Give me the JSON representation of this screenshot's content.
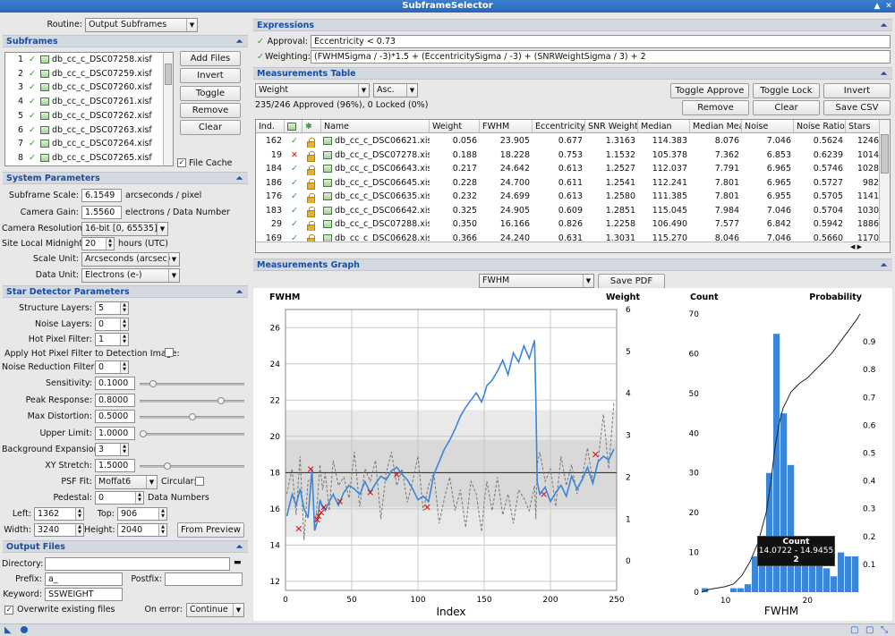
{
  "window": {
    "title": "SubframeSelector"
  },
  "routine": {
    "label": "Routine:",
    "value": "Output Subframes"
  },
  "subframes": {
    "header": "Subframes",
    "rows": [
      {
        "n": "1",
        "file": "db_cc_c_DSC07258.xisf"
      },
      {
        "n": "2",
        "file": "db_cc_c_DSC07259.xisf"
      },
      {
        "n": "3",
        "file": "db_cc_c_DSC07260.xisf"
      },
      {
        "n": "4",
        "file": "db_cc_c_DSC07261.xisf"
      },
      {
        "n": "5",
        "file": "db_cc_c_DSC07262.xisf"
      },
      {
        "n": "6",
        "file": "db_cc_c_DSC07263.xisf"
      },
      {
        "n": "7",
        "file": "db_cc_c_DSC07264.xisf"
      },
      {
        "n": "8",
        "file": "db_cc_c_DSC07265.xisf"
      }
    ],
    "buttons": [
      "Add Files",
      "Invert",
      "Toggle",
      "Remove",
      "Clear"
    ],
    "file_cache": "File Cache"
  },
  "system": {
    "header": "System Parameters",
    "subframe_scale": {
      "label": "Subframe Scale:",
      "value": "6.1549",
      "unit": "arcseconds / pixel"
    },
    "camera_gain": {
      "label": "Camera Gain:",
      "value": "1.5560",
      "unit": "electrons / Data Number"
    },
    "camera_resolution": {
      "label": "Camera Resolution:",
      "value": "16-bit [0, 65535]"
    },
    "site_midnight": {
      "label": "Site Local Midnight:",
      "value": "20",
      "unit": "hours (UTC)"
    },
    "scale_unit": {
      "label": "Scale Unit:",
      "value": "Arcseconds (arcsec)"
    },
    "data_unit": {
      "label": "Data Unit:",
      "value": "Electrons (e-)"
    }
  },
  "star": {
    "header": "Star Detector Parameters",
    "structure_layers": {
      "label": "Structure Layers:",
      "value": "5"
    },
    "noise_layers": {
      "label": "Noise Layers:",
      "value": "0"
    },
    "hot_pixel": {
      "label": "Hot Pixel Filter:",
      "value": "1"
    },
    "apply_hot": {
      "label": "Apply Hot Pixel Filter to Detection Image:"
    },
    "noise_reduction": {
      "label": "Noise Reduction Filter:",
      "value": "0"
    },
    "sensitivity": {
      "label": "Sensitivity:",
      "value": "0.1000",
      "level": 0.1
    },
    "peak_response": {
      "label": "Peak Response:",
      "value": "0.8000",
      "level": 0.8
    },
    "max_distortion": {
      "label": "Max Distortion:",
      "value": "0.5000",
      "level": 0.5
    },
    "upper_limit": {
      "label": "Upper Limit:",
      "value": "1.0000",
      "level": 0.0
    },
    "background_expansion": {
      "label": "Background Expansion:",
      "value": "3"
    },
    "xy_stretch": {
      "label": "XY Stretch:",
      "value": "1.5000",
      "level": 0.25
    },
    "psf_fit": {
      "label": "PSF Fit:",
      "value": "Moffat6"
    },
    "circular": {
      "label": "Circular:"
    },
    "pedestal": {
      "label": "Pedestal:",
      "value": "0",
      "unit": "Data Numbers"
    },
    "left": {
      "label": "Left:",
      "value": "1362"
    },
    "top": {
      "label": "Top:",
      "value": "906"
    },
    "width": {
      "label": "Width:",
      "value": "3240"
    },
    "height": {
      "label": "Height:",
      "value": "2040"
    },
    "from_preview": "From Preview"
  },
  "output": {
    "header": "Output Files",
    "directory": {
      "label": "Directory:",
      "value": ""
    },
    "prefix": {
      "label": "Prefix:",
      "value": "a_"
    },
    "postfix": {
      "label": "Postfix:",
      "value": ""
    },
    "keyword": {
      "label": "Keyword:",
      "value": "SSWEIGHT"
    },
    "overwrite": "Overwrite existing files",
    "on_error": {
      "label": "On error:",
      "value": "Continue"
    }
  },
  "expressions": {
    "header": "Expressions",
    "approval": {
      "label": "Approval:",
      "value": "Eccentricity < 0.73"
    },
    "weighting": {
      "label": "Weighting:",
      "value": "(FWHMSigma / -3)*1.5 + (EccentricitySigma / -3) + (SNRWeightSigma / 3) + 2"
    }
  },
  "measurements": {
    "header": "Measurements Table",
    "sort_key": "Weight",
    "sort_order": "Asc.",
    "summary": "235/246 Approved (96%), 0 Locked (0%)",
    "buttons": {
      "toggle_approve": "Toggle Approve",
      "toggle_lock": "Toggle Lock",
      "invert": "Invert",
      "remove": "Remove",
      "clear": "Clear",
      "save_csv": "Save CSV"
    },
    "columns": [
      "Ind.",
      "",
      "",
      "Name",
      "Weight",
      "FWHM",
      "Eccentricity",
      "SNR Weight",
      "Median",
      "Median Mea",
      "Noise",
      "Noise Ratio",
      "Stars"
    ],
    "rows": [
      {
        "ind": "162",
        "ok": true,
        "name": "db_cc_c_DSC06621.xisf",
        "weight": "0.056",
        "fwhm": "23.905",
        "ecc": "0.677",
        "snr": "1.3163",
        "median": "114.383",
        "mm": "8.076",
        "noise": "7.046",
        "nr": "0.5624",
        "stars": "1246"
      },
      {
        "ind": "19",
        "ok": false,
        "name": "db_cc_c_DSC07278.xisf",
        "weight": "0.188",
        "fwhm": "18.228",
        "ecc": "0.753",
        "snr": "1.1532",
        "median": "105.378",
        "mm": "7.362",
        "noise": "6.853",
        "nr": "0.6239",
        "stars": "1014"
      },
      {
        "ind": "184",
        "ok": true,
        "name": "db_cc_c_DSC06643.xisf",
        "weight": "0.217",
        "fwhm": "24.642",
        "ecc": "0.613",
        "snr": "1.2527",
        "median": "112.037",
        "mm": "7.791",
        "noise": "6.965",
        "nr": "0.5746",
        "stars": "1028"
      },
      {
        "ind": "186",
        "ok": true,
        "name": "db_cc_c_DSC06645.xisf",
        "weight": "0.228",
        "fwhm": "24.700",
        "ecc": "0.611",
        "snr": "1.2541",
        "median": "112.241",
        "mm": "7.801",
        "noise": "6.965",
        "nr": "0.5727",
        "stars": "982"
      },
      {
        "ind": "176",
        "ok": true,
        "name": "db_cc_c_DSC06635.xisf",
        "weight": "0.232",
        "fwhm": "24.699",
        "ecc": "0.613",
        "snr": "1.2580",
        "median": "111.385",
        "mm": "7.801",
        "noise": "6.955",
        "nr": "0.5705",
        "stars": "1141"
      },
      {
        "ind": "183",
        "ok": true,
        "name": "db_cc_c_DSC06642.xisf",
        "weight": "0.325",
        "fwhm": "24.905",
        "ecc": "0.609",
        "snr": "1.2851",
        "median": "115.045",
        "mm": "7.984",
        "noise": "7.046",
        "nr": "0.5704",
        "stars": "1030"
      },
      {
        "ind": "29",
        "ok": true,
        "name": "db_cc_c_DSC07288.xisf",
        "weight": "0.350",
        "fwhm": "16.166",
        "ecc": "0.826",
        "snr": "1.2258",
        "median": "106.490",
        "mm": "7.577",
        "noise": "6.842",
        "nr": "0.5942",
        "stars": "1886"
      },
      {
        "ind": "169",
        "ok": true,
        "name": "db_cc_c_DSC06628.xisf",
        "weight": "0.366",
        "fwhm": "24.240",
        "ecc": "0.631",
        "snr": "1.3031",
        "median": "115.270",
        "mm": "8.046",
        "noise": "7.046",
        "nr": "0.5660",
        "stars": "1170"
      }
    ]
  },
  "graph": {
    "header": "Measurements Graph",
    "y_property": "FWHM",
    "save_pdf": "Save PDF",
    "tooltip": {
      "title": "Count",
      "range": "14.0722 - 14.9455",
      "count": "2"
    }
  },
  "chart_data": [
    {
      "type": "line",
      "title": "",
      "xlabel": "Index",
      "ylabel": "FWHM",
      "y2label": "Weight",
      "xlim": [
        0,
        250
      ],
      "ylim": [
        11.5,
        27
      ],
      "y2lim": [
        -0.7,
        6
      ],
      "xticks": [
        0,
        50,
        100,
        150,
        200,
        250
      ],
      "yticks": [
        12,
        14,
        16,
        18,
        20,
        22,
        24,
        26
      ],
      "y2ticks": [
        0,
        1,
        2,
        3,
        4,
        5,
        6
      ],
      "median_line": 18.0,
      "bands": [
        [
          14.45,
          21.45
        ],
        [
          16.1,
          19.8
        ]
      ],
      "series": [
        {
          "name": "FWHM",
          "color": "#3a86d8",
          "x": [
            1,
            5,
            8,
            11,
            14,
            17,
            20,
            22,
            24,
            26,
            28,
            30,
            33,
            36,
            40,
            44,
            48,
            52,
            56,
            60,
            64,
            68,
            72,
            76,
            80,
            84,
            88,
            92,
            96,
            100,
            104,
            108,
            112,
            116,
            120,
            124,
            128,
            132,
            136,
            140,
            144,
            148,
            150,
            152,
            156,
            160,
            164,
            168,
            172,
            176,
            180,
            184,
            188,
            189,
            190,
            192,
            196,
            200,
            204,
            208,
            212,
            216,
            220,
            224,
            228,
            232,
            236,
            240,
            244,
            248
          ],
          "y": [
            15.6,
            16.8,
            16.2,
            17.1,
            16.0,
            15.5,
            18.2,
            14.8,
            15.3,
            16.5,
            16.1,
            15.9,
            16.4,
            16.8,
            16.2,
            16.9,
            17.3,
            17.1,
            16.8,
            17.5,
            16.9,
            17.4,
            17.8,
            17.6,
            18.1,
            18.3,
            17.9,
            17.6,
            17.1,
            16.5,
            16.7,
            16.4,
            17.9,
            18.6,
            19.3,
            19.8,
            20.4,
            21.1,
            21.6,
            22.0,
            22.4,
            21.9,
            22.3,
            22.8,
            23.1,
            23.6,
            24.2,
            23.4,
            24.6,
            24.1,
            25.0,
            24.3,
            25.3,
            22.0,
            17.5,
            16.8,
            17.2,
            16.4,
            16.9,
            17.3,
            16.7,
            17.8,
            17.1,
            17.6,
            18.3,
            17.4,
            18.6,
            18.9,
            18.7,
            19.3
          ]
        },
        {
          "name": "Weight",
          "color": "#777777",
          "x": [
            1,
            5,
            8,
            11,
            14,
            17,
            20,
            22,
            24,
            26,
            28,
            30,
            33,
            36,
            40,
            44,
            48,
            52,
            56,
            60,
            64,
            68,
            72,
            76,
            80,
            84,
            88,
            92,
            96,
            100,
            104,
            108,
            112,
            116,
            120,
            124,
            128,
            132,
            136,
            140,
            144,
            148,
            150,
            152,
            156,
            160,
            164,
            168,
            172,
            176,
            180,
            184,
            188,
            189,
            190,
            192,
            196,
            200,
            204,
            208,
            212,
            216,
            220,
            224,
            228,
            232,
            236,
            240,
            244,
            248
          ],
          "y": [
            1.6,
            2.2,
            1.1,
            2.5,
            0.5,
            1.9,
            2.0,
            0.8,
            1.4,
            2.3,
            1.7,
            2.1,
            1.2,
            2.4,
            1.8,
            2.0,
            1.5,
            2.6,
            1.3,
            2.2,
            1.9,
            2.4,
            1.0,
            2.1,
            2.6,
            1.8,
            2.2,
            1.4,
            1.9,
            2.5,
            1.2,
            1.8,
            2.1,
            0.9,
            1.5,
            2.0,
            1.2,
            1.7,
            0.8,
            1.9,
            1.6,
            0.7,
            1.4,
            1.9,
            1.2,
            2.0,
            1.1,
            1.6,
            0.9,
            1.7,
            1.5,
            1.2,
            1.8,
            1.0,
            2.3,
            2.6,
            1.9,
            2.2,
            1.3,
            2.5,
            1.8,
            2.3,
            1.6,
            2.0,
            2.7,
            1.9,
            2.4,
            3.5,
            2.2,
            3.8
          ]
        },
        {
          "name": "Rejected",
          "color": "#e01010",
          "x": [
            10,
            19,
            24,
            25,
            27,
            29,
            41,
            64,
            84,
            107,
            195,
            234
          ],
          "y": [
            14.9,
            18.2,
            15.4,
            15.6,
            15.8,
            16.1,
            16.4,
            16.9,
            17.9,
            16.1,
            16.8,
            19.0
          ]
        }
      ]
    },
    {
      "type": "bar",
      "title": "",
      "xlabel": "FWHM",
      "ylabel": "Count",
      "y2label": "Probability",
      "ylim": [
        0,
        70
      ],
      "y2lim": [
        0,
        1
      ],
      "xticks": [
        10,
        20
      ],
      "yticks": [
        0,
        10,
        20,
        30,
        40,
        50,
        60,
        70
      ],
      "y2ticks": [
        0.1,
        0.2,
        0.3,
        0.4,
        0.5,
        0.6,
        0.7,
        0.8,
        0.9
      ],
      "bin_width": 0.873,
      "bins_start": 7.1,
      "values": [
        1,
        0,
        0,
        0,
        1,
        1,
        2,
        9,
        14,
        30,
        65,
        45,
        32,
        11,
        7,
        9,
        10,
        6,
        4,
        10,
        9,
        9
      ],
      "cdf_x": [
        7.1,
        8,
        9,
        10,
        11,
        12,
        13,
        14,
        15,
        15.5,
        16,
        16.5,
        17,
        17.5,
        18,
        19,
        20,
        21,
        22,
        23,
        24,
        25,
        26,
        26.4
      ],
      "cdf_y": [
        0,
        0.01,
        0.015,
        0.02,
        0.03,
        0.06,
        0.11,
        0.18,
        0.29,
        0.39,
        0.51,
        0.6,
        0.66,
        0.69,
        0.72,
        0.75,
        0.77,
        0.8,
        0.83,
        0.86,
        0.9,
        0.94,
        0.98,
        1.0
      ]
    }
  ]
}
